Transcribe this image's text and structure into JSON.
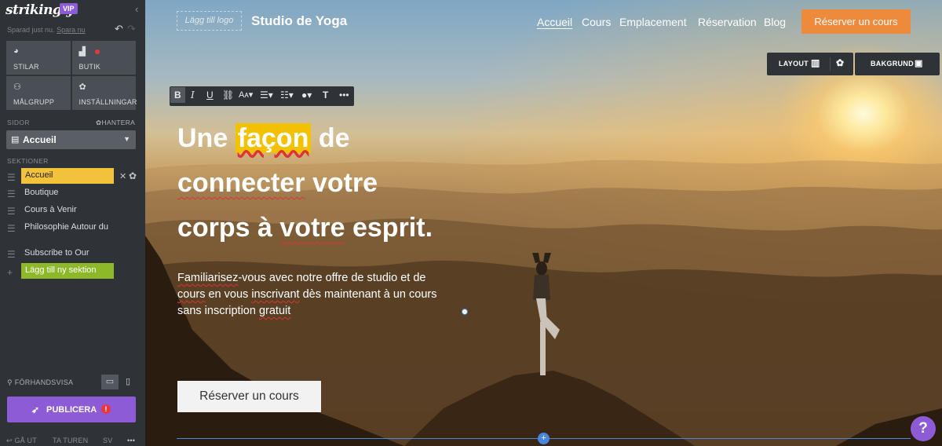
{
  "app": {
    "brand": "strikingly",
    "vip": "VIP",
    "collapse_icon": "chevron-left"
  },
  "status": {
    "saved": "Sparad just nu.",
    "save_now": "Spara nu"
  },
  "tools": [
    {
      "icon": "palette",
      "label": "STILAR"
    },
    {
      "icon": "bag",
      "label": "BUTIK"
    },
    {
      "icon": "users",
      "label": "MÅLGRUPP"
    },
    {
      "icon": "gear",
      "label": "INSTÄLLNINGAR"
    }
  ],
  "pages": {
    "label": "SIDOR",
    "manage": "HANTERA",
    "current": "Accueil"
  },
  "sections": {
    "label": "SEKTIONER",
    "items": [
      "Accueil",
      "Boutique",
      "Cours à Venir",
      "Philosophie Autour du",
      "Subscribe to Our"
    ],
    "add": "Lägg till ny sektion"
  },
  "preview": {
    "label": "FÖRHANDSVISA"
  },
  "publish": {
    "label": "PUBLICERA",
    "badge": "!"
  },
  "footer": {
    "exit": "GÅ UT",
    "tour": "TA TUREN",
    "lang": "SV",
    "more": "•••"
  },
  "site": {
    "logo_placeholder": "Lägg till logo",
    "title": "Studio de Yoga",
    "nav": [
      "Accueil",
      "Cours",
      "Emplacement",
      "Réservation",
      "Blog"
    ],
    "cta": "Réserver un cours"
  },
  "controls": {
    "layout": "LAYOUT",
    "background": "BAKGRUND"
  },
  "hero": {
    "headline_1_pre": "Une ",
    "headline_1_hl": "façon",
    "headline_1_post": " de",
    "headline_2_a": "connecter",
    "headline_2_b": " votre",
    "headline_3_a": "corps à ",
    "headline_3_b": "votre",
    "headline_3_c": " esprit.",
    "para_1a": "Familiarisez",
    "para_1b": "-vous avec notre offre de studio et de",
    "para_2a": "cours",
    "para_2b": " en vous ",
    "para_2c": "inscrivant",
    "para_2d": " dès maintenant à un cours",
    "para_3a": "sans inscription ",
    "para_3b": "gratuit",
    "button": "Réserver un cours"
  },
  "colors": {
    "accent": "#8e5bd6",
    "cta": "#ee8a3c",
    "highlight": "#f2c200",
    "section_active": "#f2c23b",
    "add_section": "#8cb82a"
  }
}
